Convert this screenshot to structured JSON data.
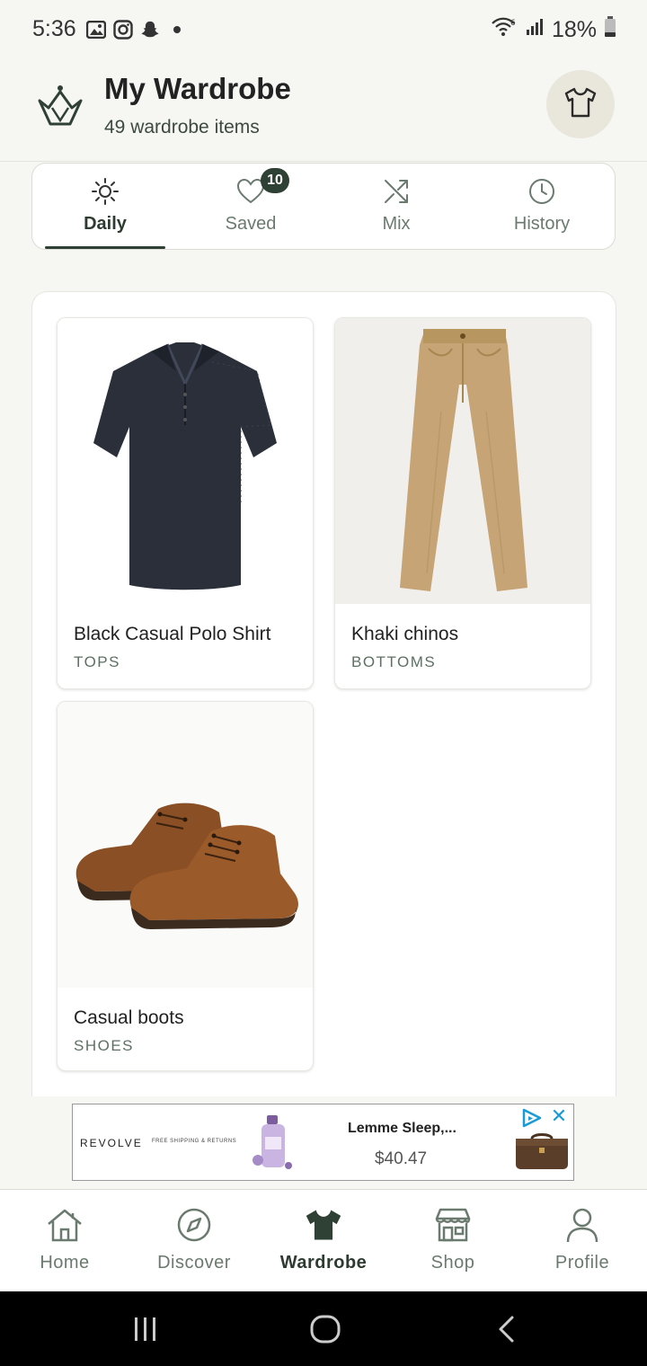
{
  "status_bar": {
    "time": "5:36",
    "battery": "18%",
    "left_icons": [
      "gallery-icon",
      "instagram-icon",
      "snapchat-icon",
      "dot-icon"
    ],
    "right_icons": [
      "wifi-icon",
      "signal-icon",
      "battery-icon"
    ]
  },
  "header": {
    "title": "My Wardrobe",
    "subtitle": "49 wardrobe items",
    "logo_icon": "crown-logo-icon",
    "action_icon": "tshirt-icon"
  },
  "tabs": [
    {
      "label": "Daily",
      "icon": "sun-icon",
      "active": true
    },
    {
      "label": "Saved",
      "icon": "heart-icon",
      "badge": "10"
    },
    {
      "label": "Mix",
      "icon": "shuffle-icon"
    },
    {
      "label": "History",
      "icon": "clock-icon"
    }
  ],
  "items": [
    {
      "name": "Black Casual Polo Shirt",
      "category": "TOPS"
    },
    {
      "name": "Khaki chinos",
      "category": "BOTTOMS"
    },
    {
      "name": "Casual boots",
      "category": "SHOES"
    }
  ],
  "ad": {
    "brand": "REVOLVE",
    "brand_sub": "FREE SHIPPING & RETURNS",
    "title": "Lemme Sleep,...",
    "price": "$40.47",
    "close": "✕"
  },
  "bottom_nav": [
    {
      "label": "Home",
      "icon": "home-icon"
    },
    {
      "label": "Discover",
      "icon": "compass-icon"
    },
    {
      "label": "Wardrobe",
      "icon": "tshirt-icon",
      "active": true
    },
    {
      "label": "Shop",
      "icon": "store-icon"
    },
    {
      "label": "Profile",
      "icon": "user-icon"
    }
  ],
  "colors": {
    "accent": "#2f4034",
    "muted": "#6b7a6e",
    "background": "#f6f6f3"
  }
}
